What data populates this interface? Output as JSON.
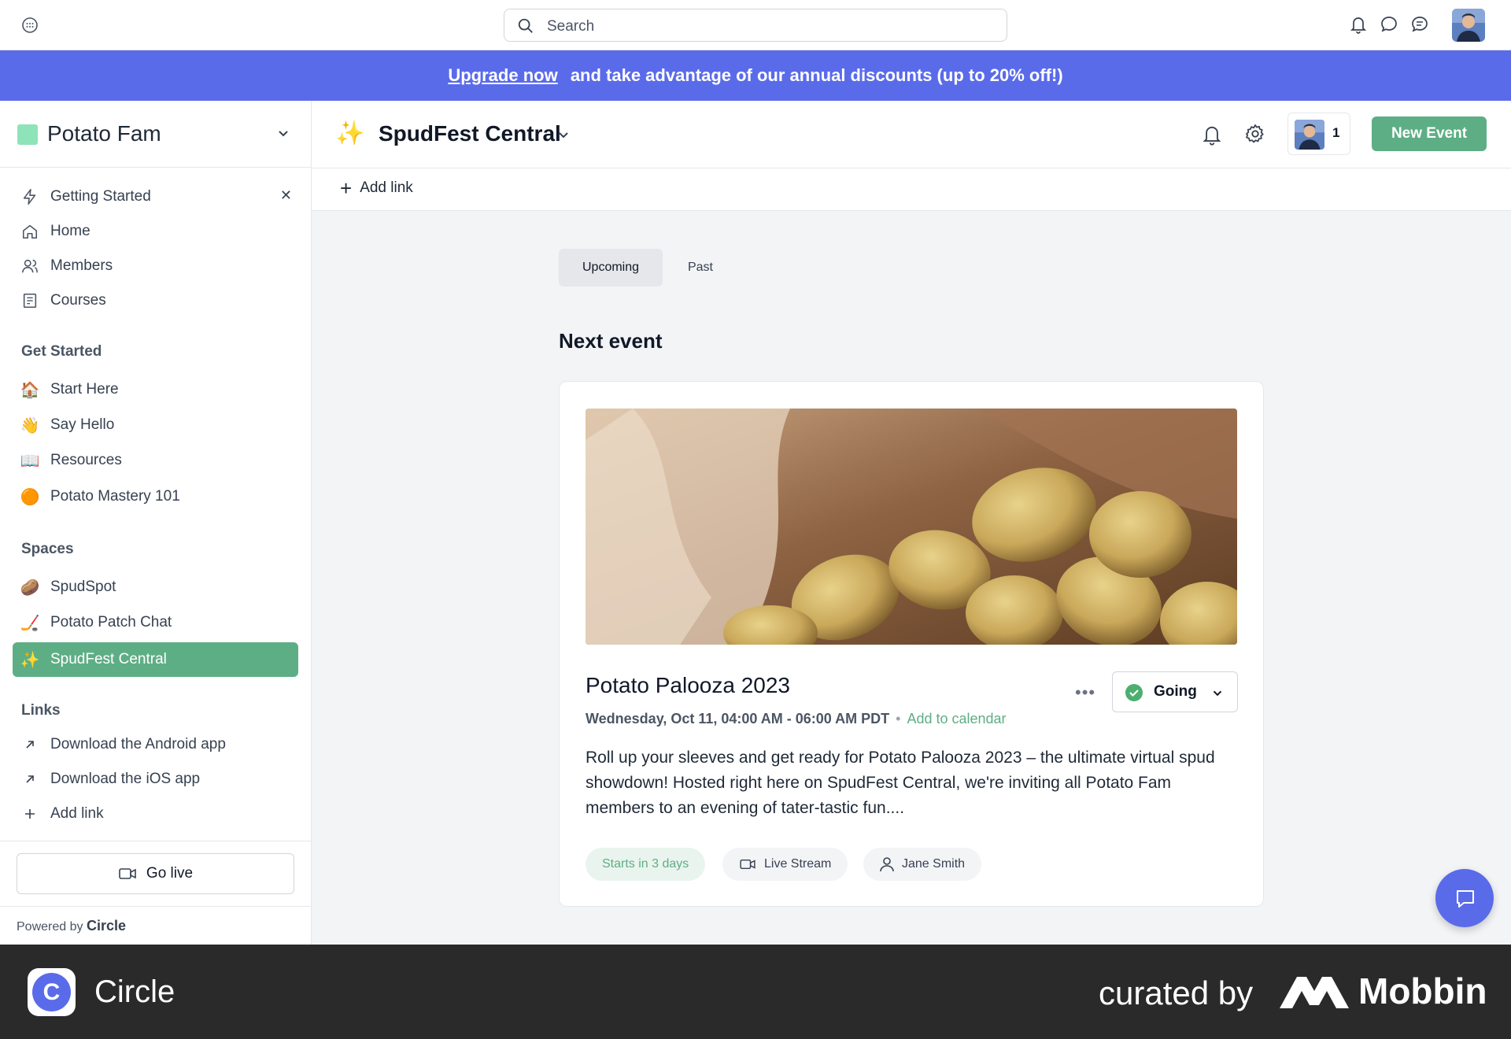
{
  "topbar": {
    "search_placeholder": "Search"
  },
  "banner": {
    "link": "Upgrade now",
    "text": "and take advantage of our annual discounts (up to 20% off!)"
  },
  "sidebar": {
    "community_name": "Potato Fam",
    "nav": [
      {
        "label": "Getting Started",
        "icon": "bolt-icon"
      },
      {
        "label": "Home",
        "icon": "home-icon"
      },
      {
        "label": "Members",
        "icon": "members-icon"
      },
      {
        "label": "Courses",
        "icon": "courses-icon"
      }
    ],
    "get_started_title": "Get Started",
    "get_started": [
      {
        "label": "Start Here",
        "emoji": "🏠"
      },
      {
        "label": "Say Hello",
        "emoji": "👋"
      },
      {
        "label": "Resources",
        "emoji": "📖"
      },
      {
        "label": "Potato Mastery 101",
        "emoji": "🟠"
      }
    ],
    "spaces_title": "Spaces",
    "spaces": [
      {
        "label": "SpudSpot",
        "emoji": "🥔"
      },
      {
        "label": "Potato Patch Chat",
        "emoji": "🏒"
      },
      {
        "label": "SpudFest Central",
        "emoji": "✨"
      }
    ],
    "links_title": "Links",
    "links": [
      {
        "label": "Download the Android app"
      },
      {
        "label": "Download the iOS app"
      },
      {
        "label": "Add link"
      }
    ],
    "go_live": "Go live",
    "powered_by": "Powered by",
    "powered_brand": "Circle"
  },
  "main": {
    "space_emoji": "✨",
    "space_title": "SpudFest Central",
    "member_count": "1",
    "new_event": "New Event",
    "add_link": "Add link",
    "tabs": [
      "Upcoming",
      "Past"
    ],
    "section_title": "Next event"
  },
  "event": {
    "title": "Potato Palooza 2023",
    "date": "Wednesday, Oct 11, 04:00 AM - 06:00 AM PDT",
    "add_to_calendar": "Add to calendar",
    "rsvp": "Going",
    "description": "Roll up your sleeves and get ready for Potato Palooza 2023 – the ultimate virtual spud showdown! Hosted right here on SpudFest Central, we're inviting all Potato Fam members to an evening of tater-tastic fun....",
    "chips": {
      "starts": "Starts in 3 days",
      "type": "Live Stream",
      "host": "Jane Smith"
    }
  },
  "footer": {
    "app_name": "Circle",
    "curated_by": "curated by",
    "brand": "Mobbin"
  },
  "colors": {
    "accent": "#5a6bea",
    "green": "#5eae85"
  }
}
